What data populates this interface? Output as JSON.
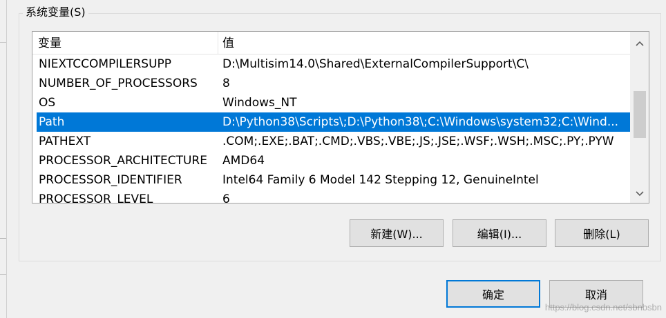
{
  "group": {
    "title": "系统变量(S)"
  },
  "list": {
    "columns": [
      "变量",
      "值"
    ],
    "rows": [
      {
        "name": "NIEXTCCOMPILERSUPP",
        "value": "D:\\Multisim14.0\\Shared\\ExternalCompilerSupport\\C\\",
        "selected": false
      },
      {
        "name": "NUMBER_OF_PROCESSORS",
        "value": "8",
        "selected": false
      },
      {
        "name": "OS",
        "value": "Windows_NT",
        "selected": false
      },
      {
        "name": "Path",
        "value": "D:\\Python38\\Scripts\\;D:\\Python38\\;C:\\Windows\\system32;C:\\Wind...",
        "selected": true
      },
      {
        "name": "PATHEXT",
        "value": ".COM;.EXE;.BAT;.CMD;.VBS;.VBE;.JS;.JSE;.WSF;.WSH;.MSC;.PY;.PYW",
        "selected": false
      },
      {
        "name": "PROCESSOR_ARCHITECTURE",
        "value": "AMD64",
        "selected": false
      },
      {
        "name": "PROCESSOR_IDENTIFIER",
        "value": "Intel64 Family 6 Model 142 Stepping 12, GenuineIntel",
        "selected": false
      },
      {
        "name": "PROCESSOR_LEVEL",
        "value": "6",
        "selected": false
      }
    ]
  },
  "buttons": {
    "new": "新建(W)...",
    "edit": "编辑(I)...",
    "delete": "删除(L)",
    "ok": "确定",
    "cancel": "取消"
  },
  "icons": {
    "scroll_up": "chevron-up-icon",
    "scroll_down": "chevron-down-icon"
  },
  "colors": {
    "selection": "#0078d7",
    "default_button_border": "#0078d7"
  },
  "watermark": "https://blog.csdn.net/sbnbsbn"
}
